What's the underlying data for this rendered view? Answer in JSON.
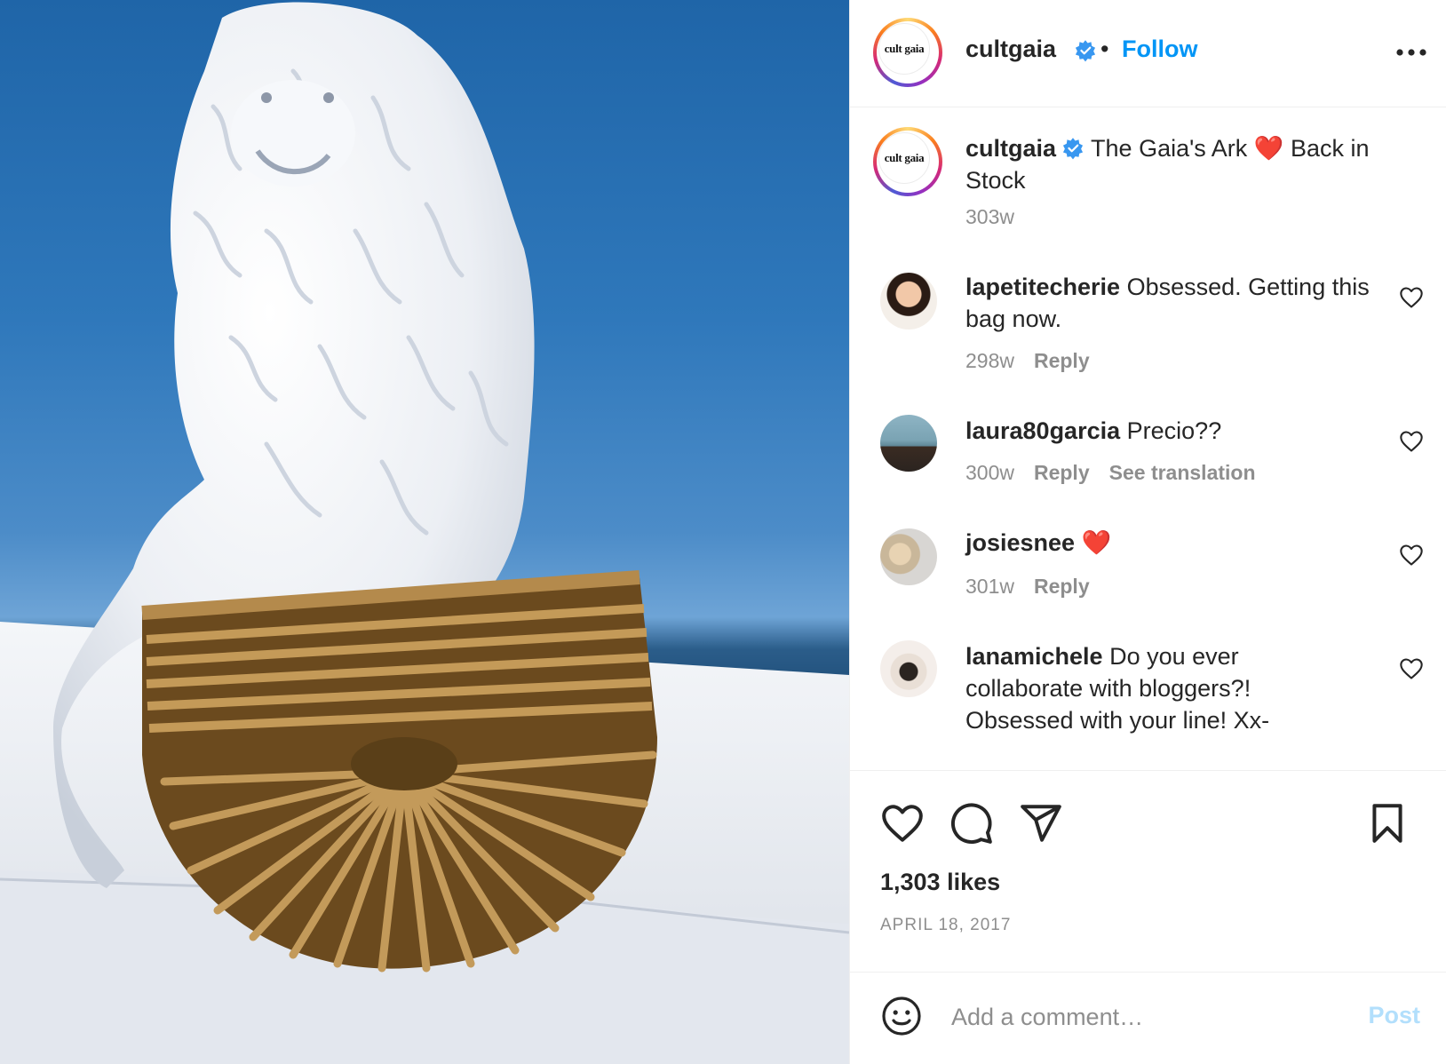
{
  "post": {
    "image_alt": "",
    "author": {
      "username": "cultgaia",
      "avatar_text": "cult gaia",
      "verified": true,
      "follow_label": "Follow",
      "separator": "•"
    },
    "caption": {
      "username": "cultgaia",
      "text_before": "The Gaia's Ark",
      "emoji": "❤️",
      "text_after": "Back in Stock",
      "time": "303w"
    },
    "comments": [
      {
        "username": "lapetitecherie",
        "text": "Obsessed. Getting this bag now.",
        "time": "298w",
        "reply_label": "Reply"
      },
      {
        "username": "laura80garcia",
        "text": "Precio??",
        "time": "300w",
        "reply_label": "Reply",
        "translate_label": "See translation"
      },
      {
        "username": "josiesnee",
        "text": "❤️",
        "time": "301w",
        "reply_label": "Reply"
      },
      {
        "username": "lanamichele",
        "text": "Do you ever collaborate with bloggers?! Obsessed with your line! Xx-",
        "time": "",
        "reply_label": ""
      }
    ],
    "likes": "1,303 likes",
    "date": "APRIL 18, 2017",
    "add_comment": {
      "placeholder": "Add a comment…",
      "post_label": "Post"
    },
    "colors": {
      "accent": "#0095f6",
      "post_disabled": "#b2dffc",
      "heart_red": "#ed4956",
      "muted": "#8e8e8e"
    },
    "icons": [
      "verified-badge-icon",
      "more-options-icon",
      "heart-icon",
      "comment-icon",
      "share-icon",
      "bookmark-icon",
      "emoji-icon"
    ]
  }
}
